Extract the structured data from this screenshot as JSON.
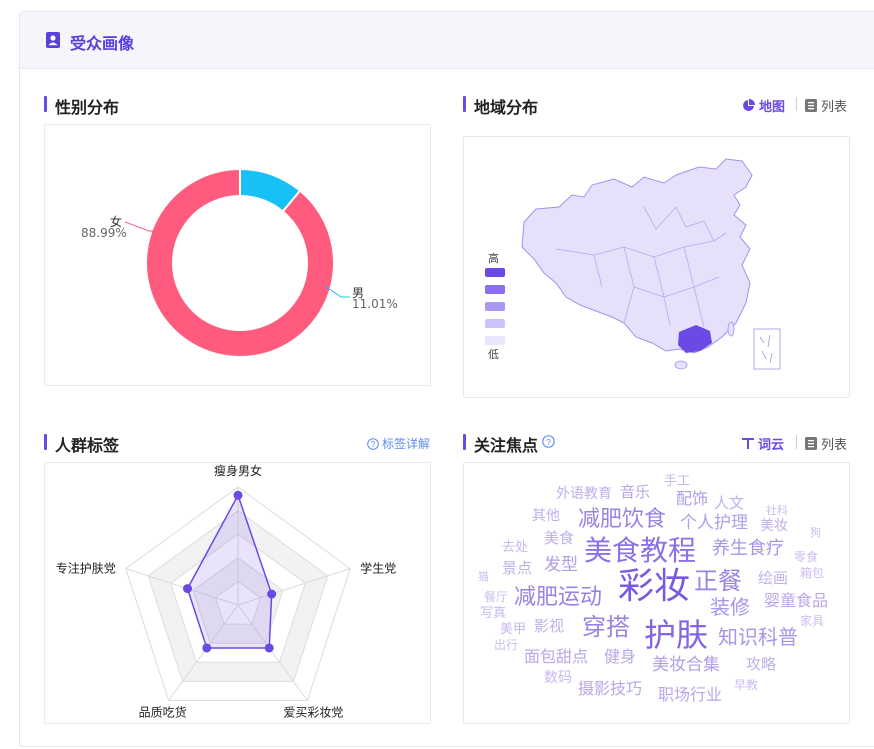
{
  "header": {
    "title": "受众画像"
  },
  "gender": {
    "title": "性别分布",
    "female": {
      "label": "女",
      "pct": "88.99%",
      "value": 88.99,
      "color": "#ff5b7f"
    },
    "male": {
      "label": "男",
      "pct": "11.01%",
      "value": 11.01,
      "color": "#17c0f5"
    }
  },
  "region": {
    "title": "地域分布",
    "toggle_map": "地图",
    "toggle_list": "列表",
    "legend_high": "高",
    "legend_low": "低",
    "legend_colors": [
      "#6a49e4",
      "#8b6ff0",
      "#aa98f4",
      "#cdc3f8",
      "#e9e5fc"
    ]
  },
  "crowd": {
    "title": "人群标签",
    "detail_link": "标签详解",
    "axes": [
      {
        "label": "瘦身男女",
        "value": 0.93
      },
      {
        "label": "学生党",
        "value": 0.3
      },
      {
        "label": "爱买彩妆党",
        "value": 0.45
      },
      {
        "label": "品质吃货",
        "value": 0.45
      },
      {
        "label": "专注护肤党",
        "value": 0.45
      }
    ]
  },
  "focus": {
    "title": "关注焦点",
    "toggle_cloud": "词云",
    "toggle_list": "列表",
    "words": [
      {
        "text": "手工",
        "size": 13,
        "color": "#c8b8ee"
      },
      {
        "text": "外语教育",
        "size": 14,
        "color": "#c0b0ea"
      },
      {
        "text": "音乐",
        "size": 15,
        "color": "#b8a6e8"
      },
      {
        "text": "配饰",
        "size": 16,
        "color": "#b09ee6"
      },
      {
        "text": "人文",
        "size": 15,
        "color": "#c0b0ea"
      },
      {
        "text": "社科",
        "size": 11,
        "color": "#ccbef0"
      },
      {
        "text": "其他",
        "size": 14,
        "color": "#c0b0ea"
      },
      {
        "text": "减肥饮食",
        "size": 22,
        "color": "#9a82e4"
      },
      {
        "text": "个人护理",
        "size": 17,
        "color": "#b09ee6"
      },
      {
        "text": "美妆",
        "size": 14,
        "color": "#c0b0ea"
      },
      {
        "text": "狗",
        "size": 11,
        "color": "#ccbef0"
      },
      {
        "text": "去处",
        "size": 13,
        "color": "#c8b8ee"
      },
      {
        "text": "美食",
        "size": 15,
        "color": "#c0b0ea"
      },
      {
        "text": "美食教程",
        "size": 28,
        "color": "#8e70e6"
      },
      {
        "text": "养生食疗",
        "size": 18,
        "color": "#a894e8"
      },
      {
        "text": "零食",
        "size": 12,
        "color": "#ccbef0"
      },
      {
        "text": "猫",
        "size": 11,
        "color": "#ccbef0"
      },
      {
        "text": "景点",
        "size": 15,
        "color": "#c0b0ea"
      },
      {
        "text": "发型",
        "size": 17,
        "color": "#b09ee6"
      },
      {
        "text": "彩妆",
        "size": 36,
        "color": "#7a58e2"
      },
      {
        "text": "正餐",
        "size": 24,
        "color": "#9a82e4"
      },
      {
        "text": "绘画",
        "size": 15,
        "color": "#c0b0ea"
      },
      {
        "text": "箱包",
        "size": 12,
        "color": "#ccbef0"
      },
      {
        "text": "餐厅",
        "size": 12,
        "color": "#ccbef0"
      },
      {
        "text": "减肥运动",
        "size": 22,
        "color": "#9a82e4"
      },
      {
        "text": "装修",
        "size": 20,
        "color": "#a894e8"
      },
      {
        "text": "婴童食品",
        "size": 16,
        "color": "#b8a6e8"
      },
      {
        "text": "写真",
        "size": 13,
        "color": "#c8b8ee"
      },
      {
        "text": "美甲",
        "size": 13,
        "color": "#c8b8ee"
      },
      {
        "text": "影视",
        "size": 15,
        "color": "#c0b0ea"
      },
      {
        "text": "穿搭",
        "size": 24,
        "color": "#9a82e4"
      },
      {
        "text": "护肤",
        "size": 32,
        "color": "#8463e4"
      },
      {
        "text": "知识科普",
        "size": 20,
        "color": "#a894e8"
      },
      {
        "text": "家具",
        "size": 12,
        "color": "#ccbef0"
      },
      {
        "text": "出行",
        "size": 12,
        "color": "#ccbef0"
      },
      {
        "text": "面包甜点",
        "size": 16,
        "color": "#b8a6e8"
      },
      {
        "text": "健身",
        "size": 16,
        "color": "#b8a6e8"
      },
      {
        "text": "美妆合集",
        "size": 17,
        "color": "#b09ee6"
      },
      {
        "text": "攻略",
        "size": 15,
        "color": "#c0b0ea"
      },
      {
        "text": "数码",
        "size": 14,
        "color": "#c8b8ee"
      },
      {
        "text": "摄影技巧",
        "size": 16,
        "color": "#b8a6e8"
      },
      {
        "text": "早教",
        "size": 12,
        "color": "#ccbef0"
      },
      {
        "text": "职场行业",
        "size": 16,
        "color": "#b8a6e8"
      }
    ]
  }
}
